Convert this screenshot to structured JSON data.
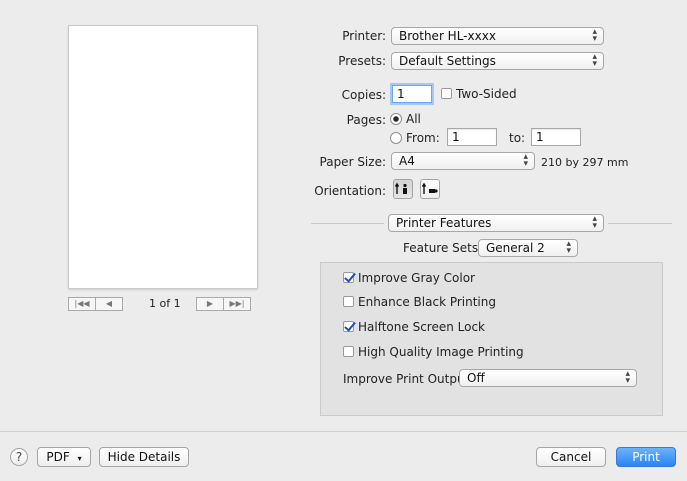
{
  "preview": {
    "pager": {
      "first_icon": "first-page-icon",
      "prev_icon": "prev-page-icon",
      "next_icon": "next-page-icon",
      "last_icon": "last-page-icon",
      "status": "1 of 1"
    }
  },
  "printer": {
    "label": "Printer:",
    "value": "Brother HL-xxxx"
  },
  "presets": {
    "label": "Presets:",
    "value": "Default Settings"
  },
  "copies": {
    "label": "Copies:",
    "value": "1",
    "two_sided_label": "Two-Sided",
    "two_sided_checked": false
  },
  "pages": {
    "label": "Pages:",
    "all_label": "All",
    "from_label": "From:",
    "from_value": "1",
    "to_label": "to:",
    "to_value": "1",
    "selected": "all"
  },
  "paper_size": {
    "label": "Paper Size:",
    "value": "A4",
    "dimensions": "210 by 297 mm"
  },
  "orientation": {
    "label": "Orientation:",
    "options": [
      "portrait",
      "landscape"
    ],
    "selected": "portrait"
  },
  "section": {
    "value": "Printer Features"
  },
  "feature_sets": {
    "label": "Feature Sets:",
    "value": "General 2"
  },
  "features": {
    "improve_gray": {
      "label": "Improve Gray Color",
      "checked": true
    },
    "enhance_black": {
      "label": "Enhance Black Printing",
      "checked": false
    },
    "halftone_lock": {
      "label": "Halftone Screen Lock",
      "checked": true
    },
    "high_quality": {
      "label": "High Quality Image Printing",
      "checked": false
    },
    "print_output": {
      "label": "Improve Print Output:",
      "value": "Off"
    }
  },
  "footer": {
    "help_label": "?",
    "pdf_label": "PDF",
    "hide_details_label": "Hide Details",
    "cancel_label": "Cancel",
    "print_label": "Print"
  },
  "colors": {
    "accent": "#2a84f5",
    "panel_bg": "#e2e2e2",
    "window_bg": "#ececec"
  }
}
